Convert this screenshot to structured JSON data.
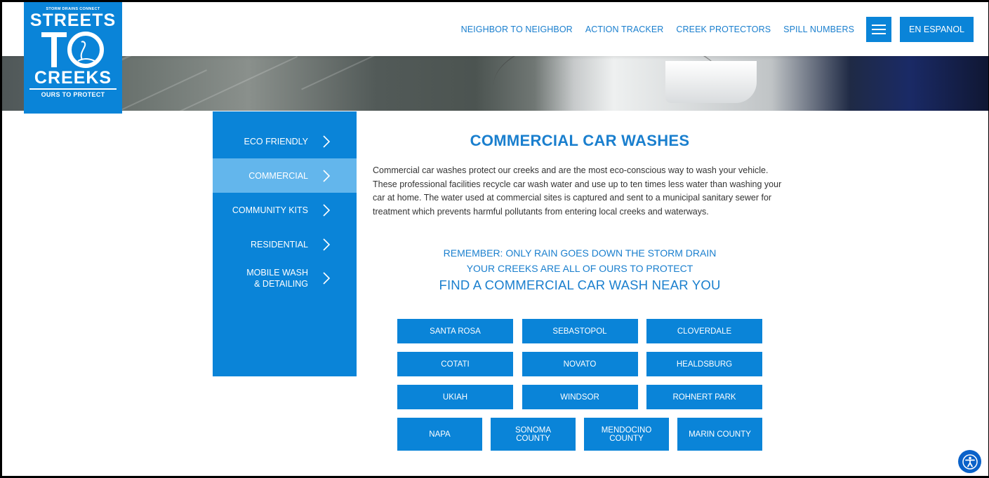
{
  "logo": {
    "tagline": "STORM DRAINS CONNECT",
    "line1": "STREETS",
    "line2": "CREEKS",
    "subtitle": "OURS TO PROTECT"
  },
  "nav": {
    "links": [
      "NEIGHBOR TO NEIGHBOR",
      "ACTION TRACKER",
      "CREEK PROTECTORS",
      "SPILL NUMBERS"
    ],
    "espanol": "EN ESPANOL"
  },
  "sidebar": {
    "items": [
      {
        "label": "ECO FRIENDLY",
        "active": false
      },
      {
        "label": "COMMERCIAL",
        "active": true
      },
      {
        "label": "COMMUNITY KITS",
        "active": false
      },
      {
        "label": "RESIDENTIAL",
        "active": false
      },
      {
        "label": "MOBILE WASH\n& DETAILING",
        "active": false
      }
    ]
  },
  "main": {
    "title": "COMMERCIAL CAR WASHES",
    "intro": "Commercial car washes protect our creeks and are the most eco-conscious way to wash your vehicle. These professional facilities recycle car wash water and use up to ten times less water than washing your car at home. The water used at commercial sites is captured and sent to a municipal sanitary sewer for treatment which prevents harmful pollutants from entering local creeks and waterways.",
    "remember1": "REMEMBER: ONLY RAIN GOES DOWN THE STORM DRAIN",
    "remember2": "YOUR CREEKS ARE ALL OF OURS TO PROTECT",
    "find": "FIND A COMMERCIAL CAR WASH NEAR YOU"
  },
  "cities": {
    "row1": [
      "SANTA ROSA",
      "SEBASTOPOL",
      "CLOVERDALE"
    ],
    "row2": [
      "COTATI",
      "NOVATO",
      "HEALDSBURG"
    ],
    "row3": [
      "UKIAH",
      "WINDSOR",
      "ROHNERT PARK"
    ],
    "row4": [
      "NAPA",
      "SONOMA\nCOUNTY",
      "MENDOCINO\nCOUNTY",
      "MARIN COUNTY"
    ]
  },
  "colors": {
    "brand_blue": "#0a84d8",
    "active_blue": "#63b6ec",
    "text_blue": "#1a7fce"
  }
}
